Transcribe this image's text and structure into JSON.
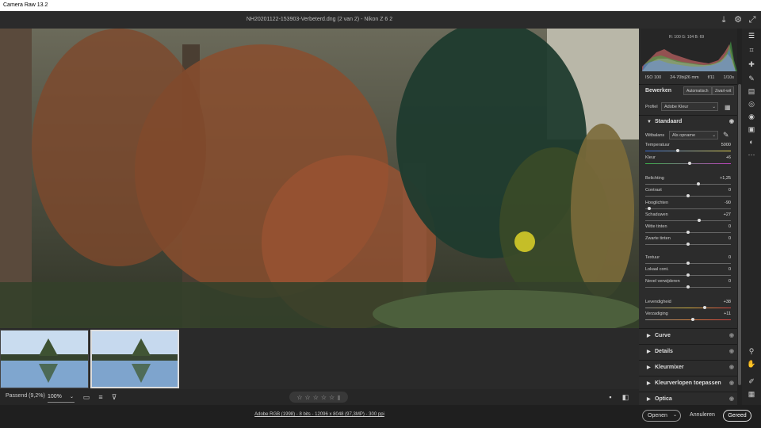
{
  "app": {
    "title": "Camera Raw 13.2"
  },
  "header": {
    "file_title": "NH20201122-153903-Verbeterd.dng  (2 van 2)   -   Nikon Z 6 2",
    "save_icon": "save-icon",
    "settings_icon": "gear-icon",
    "fullscreen_icon": "fullscreen-icon"
  },
  "bottombar": {
    "zoom_fit_label": "Passend (9,2%)",
    "zoom_value": "100%",
    "stars": [
      "☆",
      "☆",
      "☆",
      "☆",
      "☆"
    ]
  },
  "footer": {
    "workflow_link": "Adobe RGB (1998) - 8 bits - 12096 x 8048 (97,3MP) - 300 ppi",
    "open_label": "Openen",
    "cancel_label": "Annuleren",
    "done_label": "Gereed"
  },
  "panel": {
    "histogram": {
      "rgb_readout": "R: 100   G: 104   B: 69"
    },
    "exif": {
      "iso": "ISO 100",
      "lens": "24-70bij26 mm",
      "aperture": "f/11",
      "shutter": "1/10s"
    },
    "edit_title": "Bewerken",
    "auto_label": "Automatisch",
    "bw_label": "Zwart-wit",
    "profile_label": "Profiel",
    "profile_value": "Adobe Kleur",
    "basic_section": "Standaard",
    "wb_label": "Witbalans",
    "wb_value": "Als opname",
    "sliders": [
      {
        "label": "Temperatuur",
        "value": "5000",
        "pos": 0.38
      },
      {
        "label": "Kleur",
        "value": "+6",
        "pos": 0.52
      },
      {
        "label": "Belichting",
        "value": "+1,25",
        "pos": 0.62
      },
      {
        "label": "Contrast",
        "value": "0",
        "pos": 0.5
      },
      {
        "label": "Hooglichten",
        "value": "-90",
        "pos": 0.05
      },
      {
        "label": "Schaduwen",
        "value": "+27",
        "pos": 0.63
      },
      {
        "label": "Witte tinten",
        "value": "0",
        "pos": 0.5
      },
      {
        "label": "Zwarte tinten",
        "value": "0",
        "pos": 0.5
      },
      {
        "label": "Textuur",
        "value": "0",
        "pos": 0.5
      },
      {
        "label": "Lokaal cont.",
        "value": "0",
        "pos": 0.5
      },
      {
        "label": "Nevel verwijderen",
        "value": "0",
        "pos": 0.5
      },
      {
        "label": "Levendigheid",
        "value": "+38",
        "pos": 0.69
      },
      {
        "label": "Verzadiging",
        "value": "+11",
        "pos": 0.56
      }
    ],
    "sections": [
      "Curve",
      "Details",
      "Kleurmixer",
      "Kleurverlopen toepassen",
      "Optica"
    ]
  }
}
